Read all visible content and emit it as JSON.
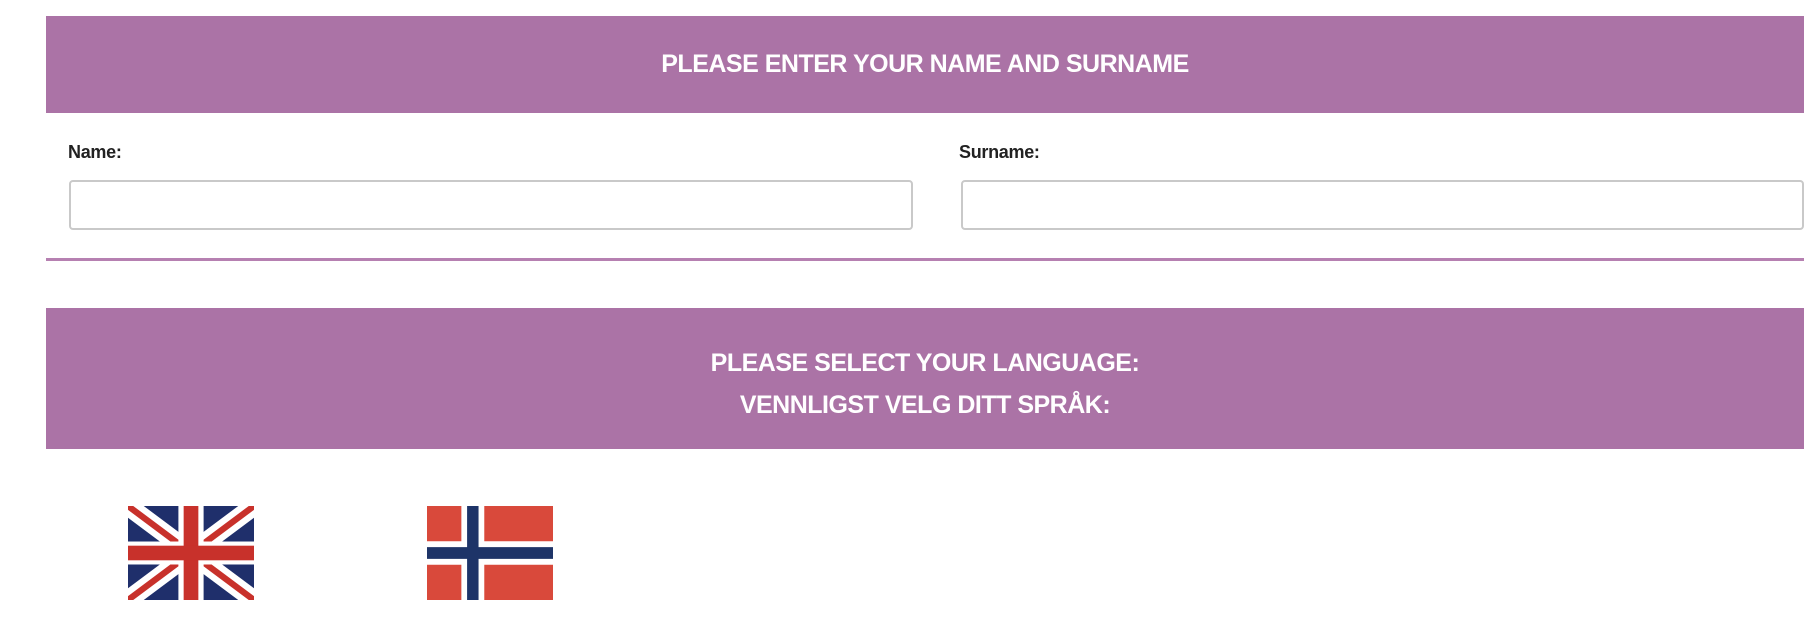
{
  "name_section": {
    "header": "PLEASE ENTER YOUR NAME AND SURNAME",
    "name_label": "Name:",
    "name_value": "",
    "surname_label": "Surname:",
    "surname_value": ""
  },
  "language_section": {
    "header_line1": "PLEASE SELECT YOUR LANGUAGE:",
    "header_line2": "VENNLIGST VELG DITT SPRÅK:",
    "options": [
      {
        "language": "English",
        "icon": "uk-flag-icon"
      },
      {
        "language": "Norwegian",
        "icon": "norway-flag-icon"
      }
    ]
  },
  "colors": {
    "banner": "#ab73a6",
    "banner_text": "#ffffff",
    "divider": "#b680b1",
    "uk_blue": "#1f2f6b",
    "uk_red": "#c8312b",
    "no_red": "#d9493b",
    "no_blue": "#1e3468"
  }
}
